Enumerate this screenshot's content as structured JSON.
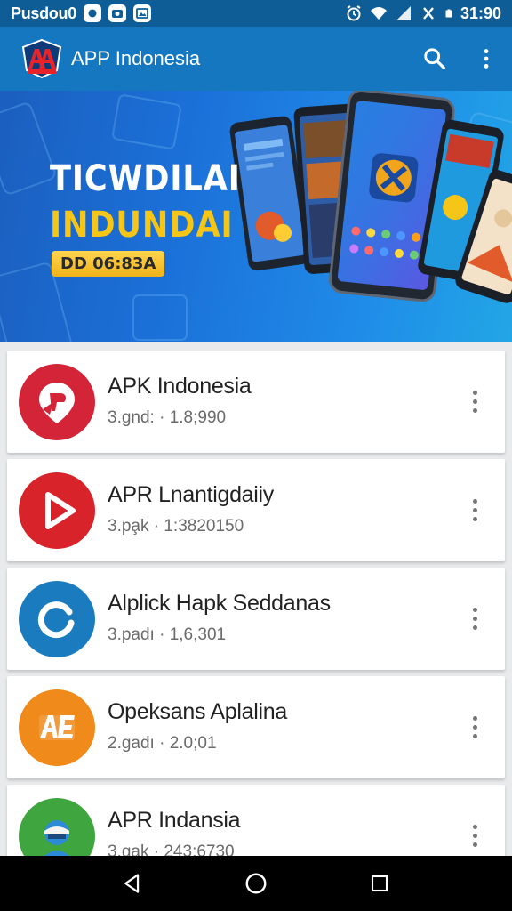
{
  "status_bar": {
    "carrier": "Pusdou0",
    "time": "31:90",
    "notif_icons": [
      "record-icon",
      "camera-icon",
      "photo-icon"
    ]
  },
  "app_bar": {
    "title": "APP Indonesia",
    "actions": [
      "search-icon",
      "more-vert-icon"
    ]
  },
  "banner": {
    "headline": "TICWDILAI",
    "subline": "INDUNDAI",
    "badge": "DD 06:83A",
    "colors": {
      "headline": "#ffffff",
      "subline": "#f5c518",
      "badge": "#f0b21a"
    }
  },
  "apps": [
    {
      "name": "APK Indonesia",
      "meta": "3.gnd: · 1.8;990",
      "icon": "pin-logo-icon",
      "color": "#d42438"
    },
    {
      "name": "APR Lnantigdaiiy",
      "meta": "3.pa̧k · 1:3820150",
      "icon": "play-icon",
      "color": "#d8232a"
    },
    {
      "name": "Alplick Hapk Seddanas",
      "meta": "3.padı · 1,6,301",
      "icon": "refresh-ring-icon",
      "color": "#1a7bbf"
    },
    {
      "name": "Opeksans Aplalina",
      "meta": "2.gadı · 2.0;01",
      "icon": "ae-letters-icon",
      "color": "#f08a1a"
    },
    {
      "name": "APR Indansia",
      "meta": "3.gak · 243:6730",
      "icon": "character-icon",
      "color": "#3fa63f"
    }
  ],
  "nav_bar": [
    "back-icon",
    "home-icon",
    "recents-icon"
  ]
}
